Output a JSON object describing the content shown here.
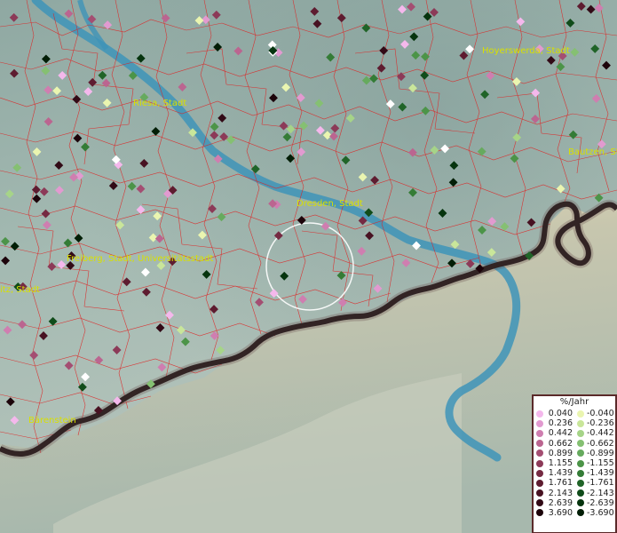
{
  "map": {
    "cities": [
      {
        "name": "Riesa, Stadt"
      },
      {
        "name": "Hoyerswerda, Stadt"
      },
      {
        "name": "Bautzen, St"
      },
      {
        "name": "Dresden, Stadt"
      },
      {
        "name": "Freiberg, Stadt, Universitätsstadt"
      },
      {
        "name": "itz, Stadt"
      },
      {
        "name": "Bärenstein"
      }
    ]
  },
  "legend": {
    "title": "%/Jahr",
    "positive": [
      {
        "value": "0.040",
        "color": "#f4b8ec"
      },
      {
        "value": "0.236",
        "color": "#e29ad0"
      },
      {
        "value": "0.442",
        "color": "#cf7eb0"
      },
      {
        "value": "0.662",
        "color": "#bb6590"
      },
      {
        "value": "0.899",
        "color": "#a44e72"
      },
      {
        "value": "1.155",
        "color": "#8c3a58"
      },
      {
        "value": "1.439",
        "color": "#752a42"
      },
      {
        "value": "1.761",
        "color": "#5e1c30"
      },
      {
        "value": "2.143",
        "color": "#481222"
      },
      {
        "value": "2.639",
        "color": "#320a16"
      },
      {
        "value": "3.690",
        "color": "#1c040a"
      }
    ],
    "negative": [
      {
        "value": "-0.040",
        "color": "#eaf5b0"
      },
      {
        "value": "-0.236",
        "color": "#c9e69a"
      },
      {
        "value": "-0.442",
        "color": "#a6d488"
      },
      {
        "value": "-0.662",
        "color": "#85c072"
      },
      {
        "value": "-0.899",
        "color": "#66aa5e"
      },
      {
        "value": "-1.155",
        "color": "#4c9448"
      },
      {
        "value": "-1.439",
        "color": "#347c36"
      },
      {
        "value": "-1.761",
        "color": "#206428"
      },
      {
        "value": "-2.143",
        "color": "#104c1a"
      },
      {
        "value": "-2.639",
        "color": "#06340e"
      },
      {
        "value": "-3.690",
        "color": "#021e06"
      }
    ]
  }
}
